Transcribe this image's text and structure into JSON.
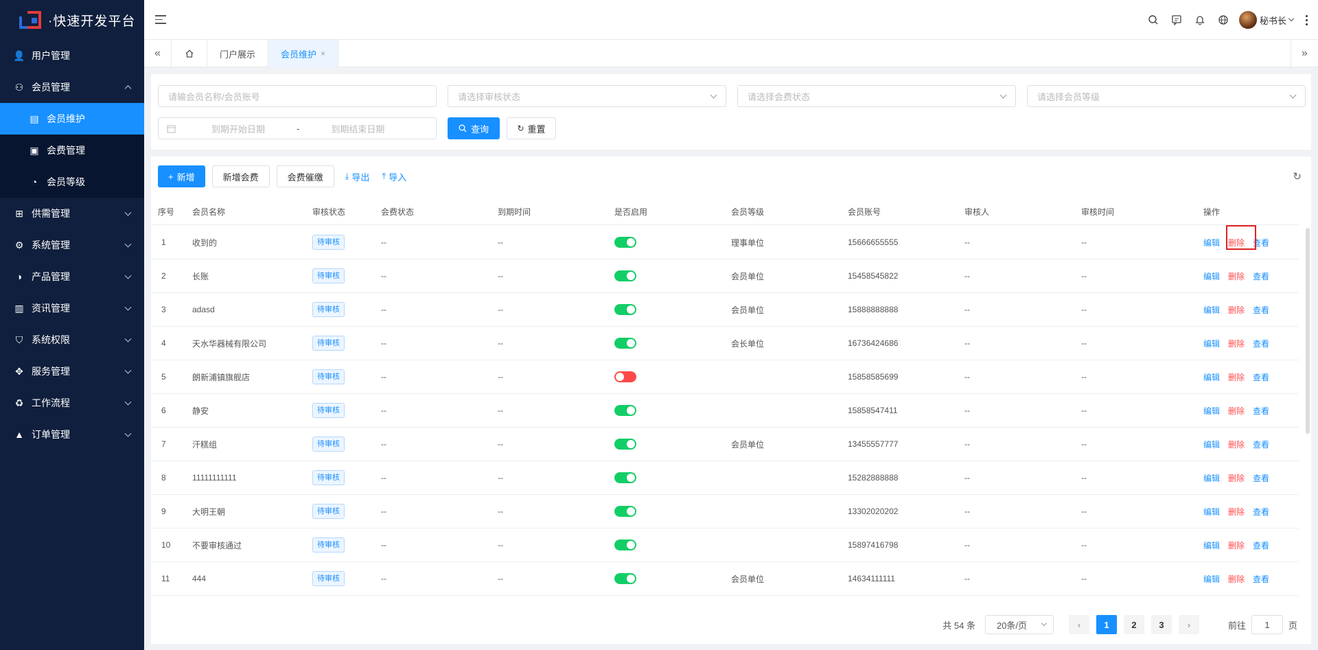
{
  "app": {
    "logo_text": "·快速开发平台"
  },
  "sidebar": {
    "items": [
      {
        "label": "用户管理",
        "icon": "user-icon"
      },
      {
        "label": "会员管理",
        "icon": "member-icon",
        "expanded": true,
        "children": [
          {
            "label": "会员维护",
            "icon": "table-icon",
            "active": true
          },
          {
            "label": "会费管理",
            "icon": "fee-icon"
          },
          {
            "label": "会员等级",
            "icon": "level-icon"
          }
        ]
      },
      {
        "label": "供需管理",
        "icon": "grid-icon"
      },
      {
        "label": "系统管理",
        "icon": "gear-icon"
      },
      {
        "label": "产品管理",
        "icon": "product-icon"
      },
      {
        "label": "资讯管理",
        "icon": "document-icon"
      },
      {
        "label": "系统权限",
        "icon": "shield-icon"
      },
      {
        "label": "服务管理",
        "icon": "service-icon"
      },
      {
        "label": "工作流程",
        "icon": "workflow-icon"
      },
      {
        "label": "订单管理",
        "icon": "order-icon"
      }
    ]
  },
  "header": {
    "username": "秘书长"
  },
  "tabs": [
    {
      "label": "门户展示"
    },
    {
      "label": "会员维护",
      "active": true,
      "closable": "×"
    }
  ],
  "filters": {
    "name_placeholder": "请输会员名称/会员账号",
    "audit_placeholder": "请选择审核状态",
    "fee_placeholder": "请选择会费状态",
    "level_placeholder": "请选择会员等级",
    "start_placeholder": "到期开始日期",
    "range_sep": "-",
    "end_placeholder": "到期结束日期",
    "query_label": "查询",
    "reset_label": "重置"
  },
  "toolbar": {
    "add_label": "新增",
    "add_fee_label": "新增会费",
    "remind_label": "会费催缴",
    "export_label": "导出",
    "import_label": "导入"
  },
  "table": {
    "columns": [
      "序号",
      "会员名称",
      "审核状态",
      "会费状态",
      "到期时间",
      "是否启用",
      "会员等级",
      "会员账号",
      "审核人",
      "审核时间",
      "操作"
    ],
    "actions": {
      "edit": "编辑",
      "delete": "删除",
      "view": "查看"
    },
    "rows": [
      {
        "no": "1",
        "name": "收到的",
        "audit": "待审核",
        "fee": "--",
        "expire": "--",
        "enabled": true,
        "level": "理事单位",
        "account": "15666655555",
        "auditor": "--",
        "audit_time": "--"
      },
      {
        "no": "2",
        "name": "长账",
        "audit": "待审核",
        "fee": "--",
        "expire": "--",
        "enabled": true,
        "level": "会员单位",
        "account": "15458545822",
        "auditor": "--",
        "audit_time": "--"
      },
      {
        "no": "3",
        "name": "adasd",
        "audit": "待审核",
        "fee": "--",
        "expire": "--",
        "enabled": true,
        "level": "会员单位",
        "account": "15888888888",
        "auditor": "--",
        "audit_time": "--"
      },
      {
        "no": "4",
        "name": "天水华器械有限公司",
        "audit": "待审核",
        "fee": "--",
        "expire": "--",
        "enabled": true,
        "level": "会长单位",
        "account": "16736424686",
        "auditor": "--",
        "audit_time": "--"
      },
      {
        "no": "5",
        "name": "朗新浦镇旗舰店",
        "audit": "待审核",
        "fee": "--",
        "expire": "--",
        "enabled": false,
        "level": "",
        "account": "15858585699",
        "auditor": "--",
        "audit_time": "--"
      },
      {
        "no": "6",
        "name": "静安",
        "audit": "待审核",
        "fee": "--",
        "expire": "--",
        "enabled": true,
        "level": "",
        "account": "15858547411",
        "auditor": "--",
        "audit_time": "--"
      },
      {
        "no": "7",
        "name": "汗糕组",
        "audit": "待审核",
        "fee": "--",
        "expire": "--",
        "enabled": true,
        "level": "会员单位",
        "account": "13455557777",
        "auditor": "--",
        "audit_time": "--"
      },
      {
        "no": "8",
        "name": "11111111111",
        "audit": "待审核",
        "fee": "--",
        "expire": "--",
        "enabled": true,
        "level": "",
        "account": "15282888888",
        "auditor": "--",
        "audit_time": "--"
      },
      {
        "no": "9",
        "name": "大明王朝",
        "audit": "待审核",
        "fee": "--",
        "expire": "--",
        "enabled": true,
        "level": "",
        "account": "13302020202",
        "auditor": "--",
        "audit_time": "--"
      },
      {
        "no": "10",
        "name": "不要审核通过",
        "audit": "待审核",
        "fee": "--",
        "expire": "--",
        "enabled": true,
        "level": "",
        "account": "15897416798",
        "auditor": "--",
        "audit_time": "--"
      },
      {
        "no": "11",
        "name": "444",
        "audit": "待审核",
        "fee": "--",
        "expire": "--",
        "enabled": true,
        "level": "会员单位",
        "account": "14634111111",
        "auditor": "--",
        "audit_time": "--"
      }
    ]
  },
  "pagination": {
    "total_text": "共 54 条",
    "page_size": "20条/页",
    "pages": [
      "1",
      "2",
      "3"
    ],
    "current": "1",
    "goto_label": "前往",
    "goto_value": "1",
    "page_unit": "页"
  }
}
